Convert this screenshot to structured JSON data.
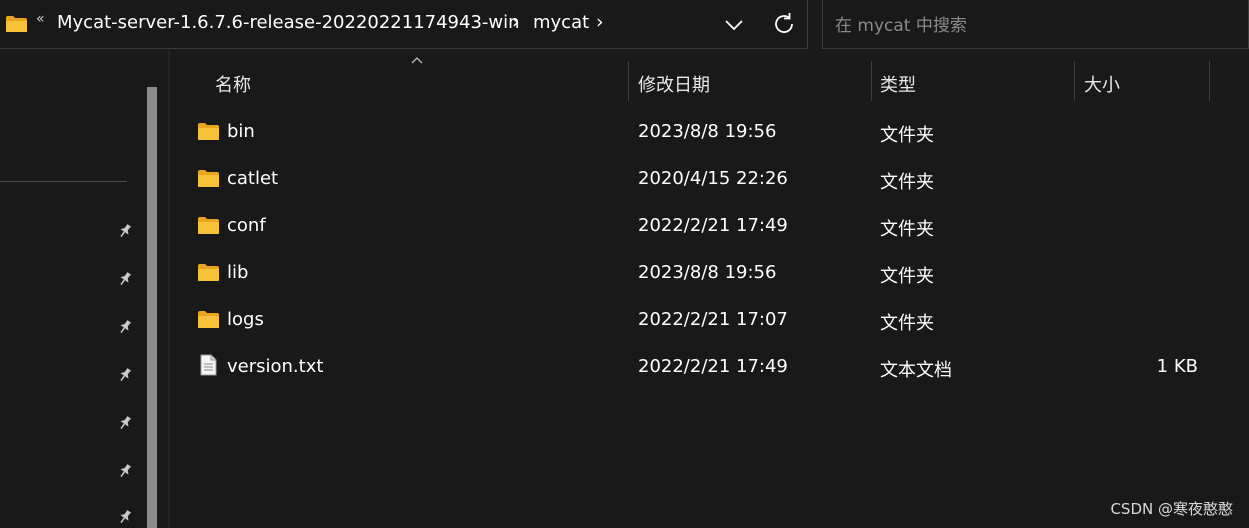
{
  "address_bar": {
    "overflow_glyph": "«",
    "breadcrumbs": [
      "Mycat-server-1.6.7.6-release-20220221174943-win",
      "mycat"
    ],
    "separator": "›"
  },
  "search": {
    "placeholder": "在 mycat 中搜索"
  },
  "columns": {
    "name": "名称",
    "date": "修改日期",
    "type": "类型",
    "size": "大小"
  },
  "files": [
    {
      "name": "bin",
      "date": "2023/8/8 19:56",
      "type": "文件夹",
      "size": "",
      "icon": "folder-icon"
    },
    {
      "name": "catlet",
      "date": "2020/4/15 22:26",
      "type": "文件夹",
      "size": "",
      "icon": "folder-icon"
    },
    {
      "name": "conf",
      "date": "2022/2/21 17:49",
      "type": "文件夹",
      "size": "",
      "icon": "folder-icon"
    },
    {
      "name": "lib",
      "date": "2023/8/8 19:56",
      "type": "文件夹",
      "size": "",
      "icon": "folder-icon"
    },
    {
      "name": "logs",
      "date": "2022/2/21 17:07",
      "type": "文件夹",
      "size": "",
      "icon": "folder-icon"
    },
    {
      "name": "version.txt",
      "date": "2022/2/21 17:49",
      "type": "文本文档",
      "size": "1 KB",
      "icon": "text-file-icon"
    }
  ],
  "watermark": "CSDN @寒夜憨憨",
  "colors": {
    "background": "#191919",
    "folder": "#f8c13a",
    "text": "#ffffff",
    "muted": "#8a8a8a"
  }
}
